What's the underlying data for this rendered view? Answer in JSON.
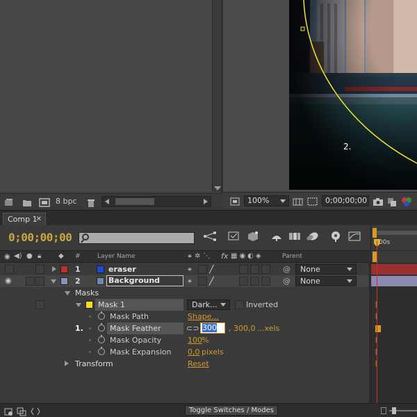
{
  "project_panel": {
    "footer": {
      "bpc_label": "8 bpc"
    }
  },
  "viewer": {
    "marker_label": "2.",
    "footer": {
      "zoom": "100%",
      "timecode": "0;00;00;00"
    }
  },
  "timeline": {
    "tab_label": "Comp 1",
    "timecode": "0;00;00;00",
    "ruler_label": "00s",
    "columns": {
      "number": "#",
      "layer_name": "Layer Name",
      "parent": "Parent"
    },
    "layers": [
      {
        "number": "1",
        "name": "eraser",
        "color": "#c0302a",
        "parent": "None"
      },
      {
        "number": "2",
        "name": "Background",
        "color": "#8c8fb8",
        "parent": "None"
      }
    ],
    "masks_label": "Masks",
    "mask": {
      "name": "Mask 1",
      "color": "#f0e020",
      "mode": "Dark...",
      "inverted_label": "Inverted"
    },
    "properties": {
      "mask_path": {
        "label": "Mask Path",
        "value": "Shape..."
      },
      "mask_feather": {
        "label": "Mask Feather",
        "value_edit": "300",
        "value_rest": ", 300,0",
        "value_units": "...xels",
        "step_marker": "1."
      },
      "mask_opacity": {
        "label": "Mask Opacity",
        "value": "100",
        "unit": "%"
      },
      "mask_expansion": {
        "label": "Mask Expansion",
        "value": "0,0",
        "unit": "pixels"
      }
    },
    "transform": {
      "label": "Transform",
      "reset": "Reset"
    },
    "toggle_label": "Toggle Switches / Modes"
  }
}
